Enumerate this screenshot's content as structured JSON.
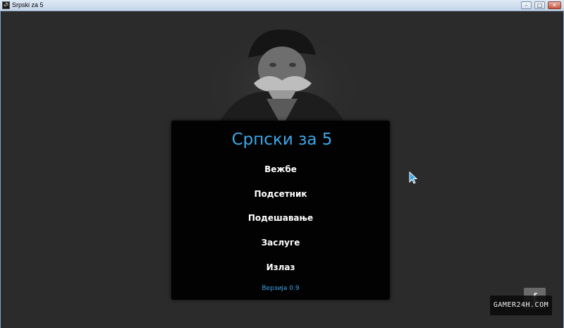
{
  "window": {
    "title": "Srpski za 5",
    "icon_glyph": "Ⴐ",
    "controls": {
      "minimize": "–",
      "maximize": "□",
      "close": "✕"
    }
  },
  "game": {
    "title": "Српски за 5",
    "menu": [
      "Вежбе",
      "Подсетник",
      "Подешавање",
      "Заслуге",
      "Излаз"
    ],
    "version": "Верзија 0.9"
  },
  "social": {
    "facebook_glyph": "f"
  },
  "watermark": {
    "text": "GAMER24H.COM"
  },
  "colors": {
    "background": "#2b2b2b",
    "panel": "#020202",
    "accent": "#3da7e8",
    "menu_text": "#ffffff"
  }
}
